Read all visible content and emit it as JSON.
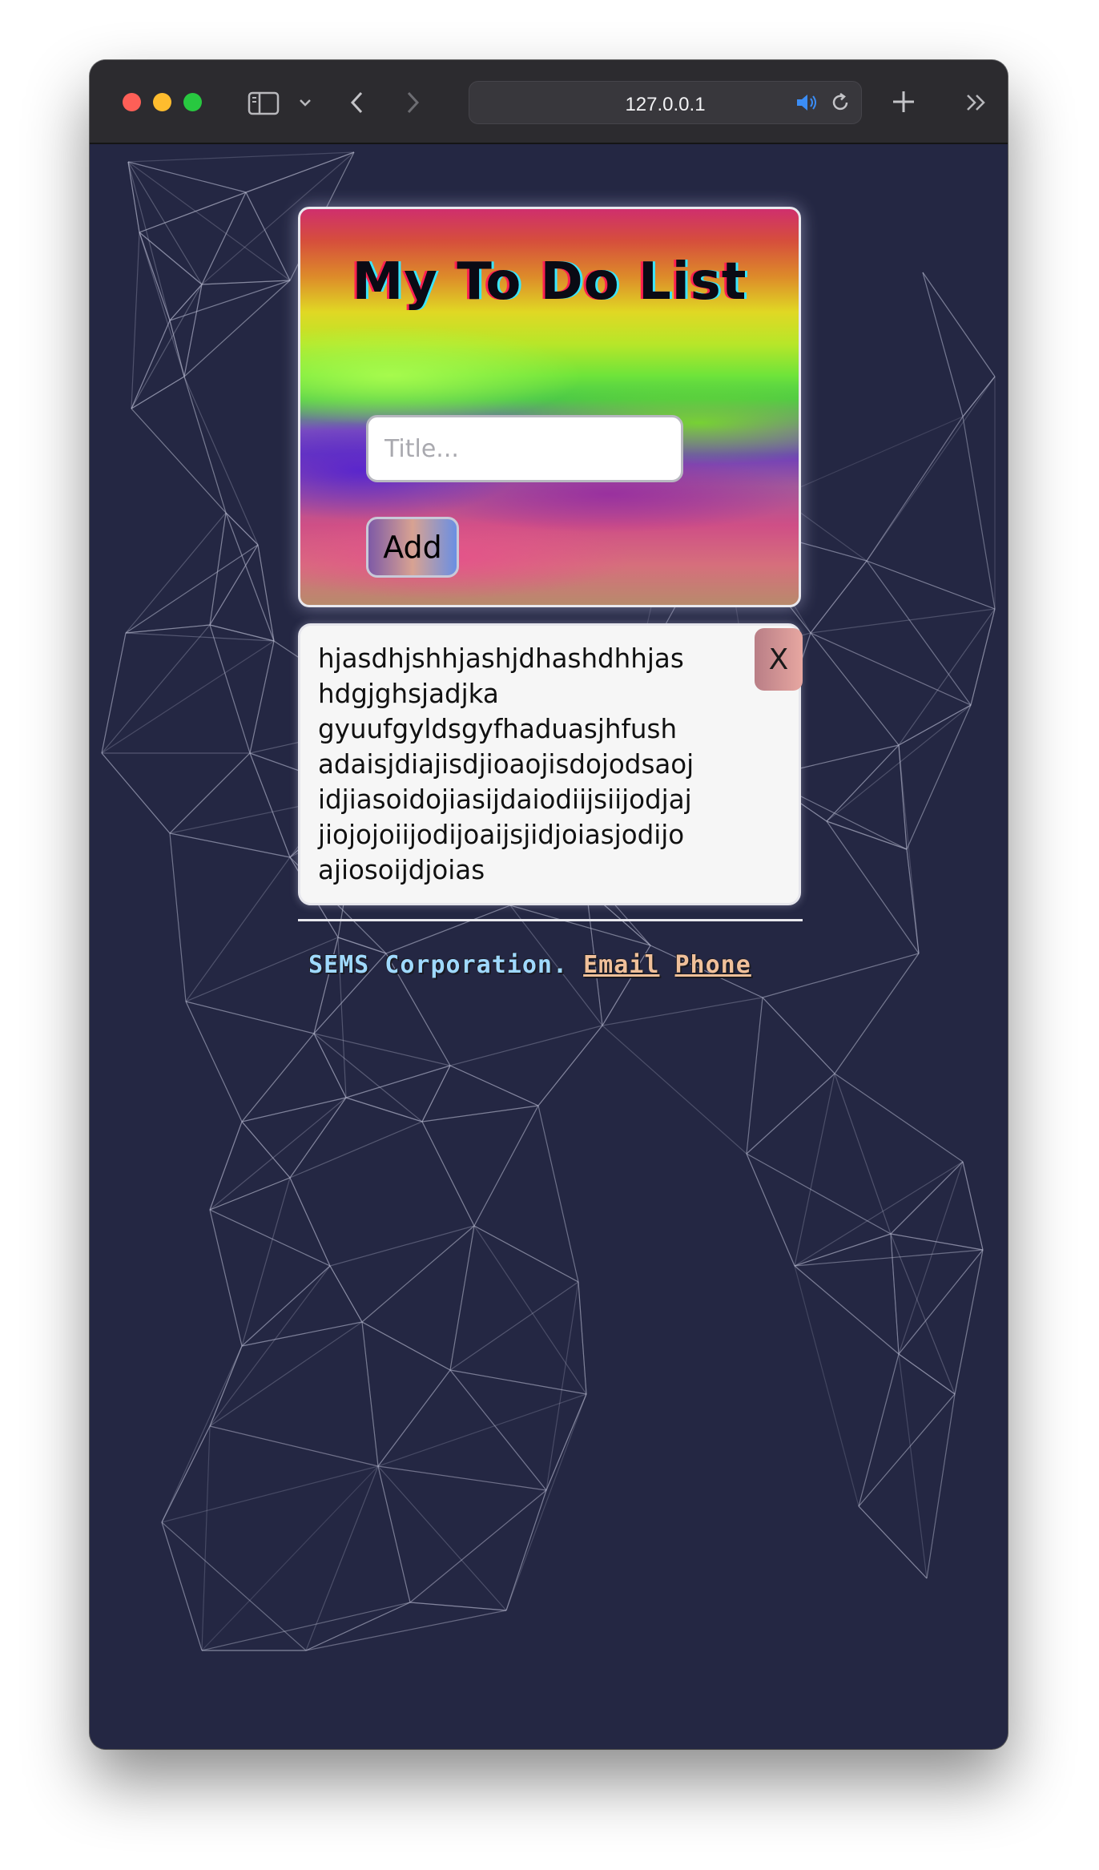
{
  "browser": {
    "url": "127.0.0.1"
  },
  "app": {
    "title": "My To Do List",
    "title_input_placeholder": "Title...",
    "title_input_value": "",
    "add_label": "Add"
  },
  "tasks": [
    {
      "text": "hjasdhjshhjashjdhashdhhjashdgjghsjadjka gyuufgyldsgyfhaduasjhfush adaisjdiajisdjioaojisdojodsaojidjiasoidojiasijdaiodiijsiijodjajjiojojoiijodijoaijsjidjoiasjodijoajiosoijdjoias",
      "lines": [
        "hjasdhjshhjashjdhashdhhjas",
        "hdgjghsjadjka",
        "gyuufgyldsgyfhaduasjhfush",
        "adaisjdiajisdjioaojisdojodsaoj",
        "idjiasoidojiasijdaiodiijsiijodjaj",
        "jiojojoiijodijoaijsjidjoiasjodijo",
        "ajiosoijdjoias"
      ],
      "delete_label": "X"
    }
  ],
  "footer": {
    "company": "SEMS Corporation.",
    "email_label": "Email",
    "phone_label": "Phone"
  },
  "colors": {
    "page_background": "#242743",
    "network_lines": "#b4b6cc",
    "footer_text": "#9fd9ff",
    "footer_links": "#f0c09a"
  },
  "icons": [
    "sidebar-icon",
    "chevron-down-icon",
    "back-icon",
    "forward-icon",
    "speaker-icon",
    "reload-icon",
    "plus-icon",
    "more-icon"
  ]
}
